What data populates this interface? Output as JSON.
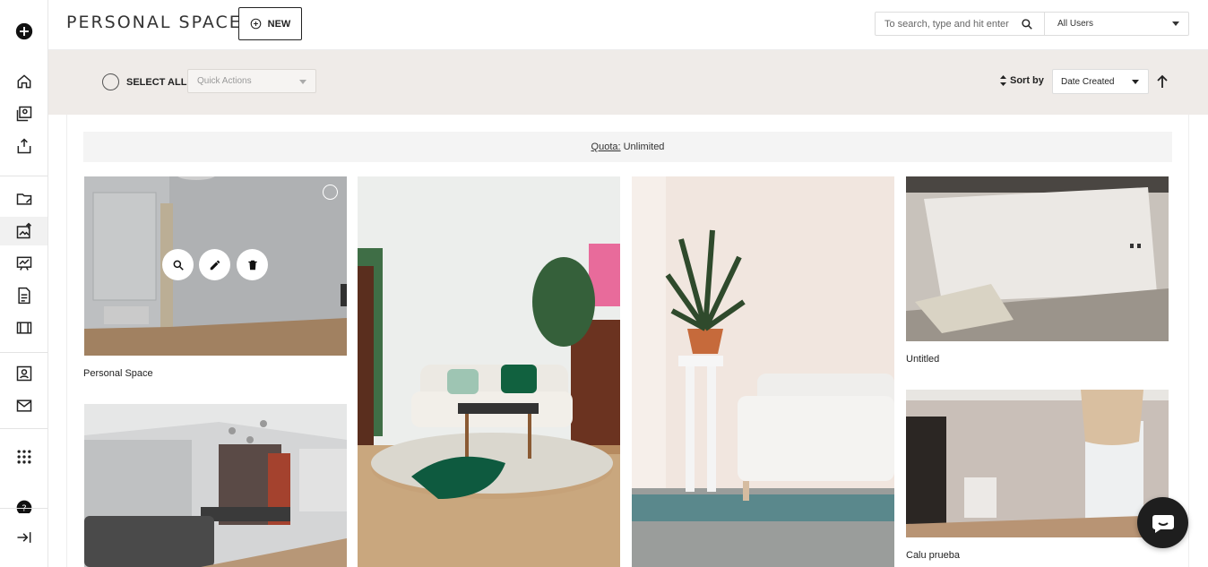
{
  "header": {
    "title": "PERSONAL SPACES",
    "new_label": "NEW",
    "search_placeholder": "To search, type and hit enter",
    "users_filter": "All Users"
  },
  "toolbar": {
    "select_all": "SELECT ALL",
    "quick_actions": "Quick Actions",
    "sort_by": "Sort by",
    "sort_value": "Date Created"
  },
  "quota": {
    "label": "Quota:",
    "value": "Unlimited"
  },
  "cards": [
    {
      "label": "Personal Space"
    },
    {
      "label": ""
    },
    {
      "label": ""
    },
    {
      "label": "Untitled"
    },
    {
      "label": ""
    },
    {
      "label": "Calu prueba"
    }
  ],
  "colors": {
    "band": "#efebe8",
    "accent": "#1e1e1e"
  }
}
